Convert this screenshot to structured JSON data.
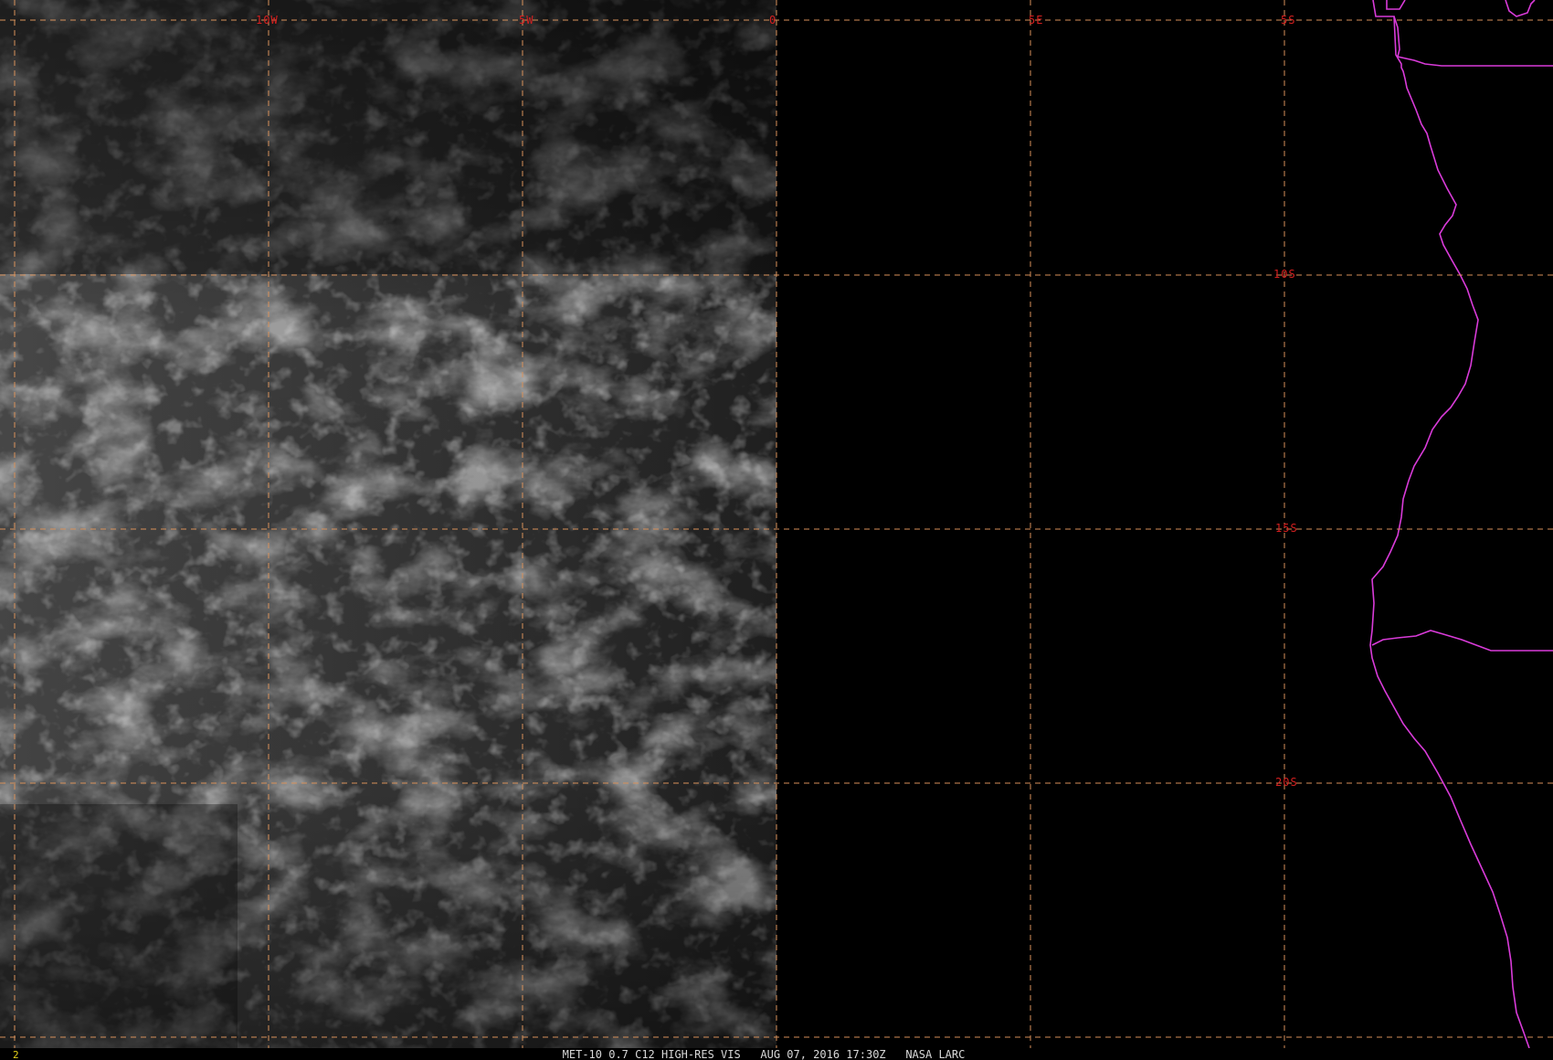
{
  "image": {
    "kind": "satellite-visible-imagery",
    "background_color": "#000000",
    "grid_color": "#d8915a",
    "label_color": "#d61f1f",
    "coastline_color": "#d93bd9",
    "caption_color": "#d8d8d8",
    "frame_number_color": "#e6d21a"
  },
  "grid": {
    "longitude_labels": [
      "10W",
      "5W",
      "0",
      "5E"
    ],
    "latitude_labels": [
      "5S",
      "10S",
      "15S",
      "20S"
    ]
  },
  "footer": {
    "frame_number": "2",
    "caption": "MET-10 0.7 C12 HIGH-RES VIS   AUG 07, 2016 17:30Z   NASA LARC"
  }
}
